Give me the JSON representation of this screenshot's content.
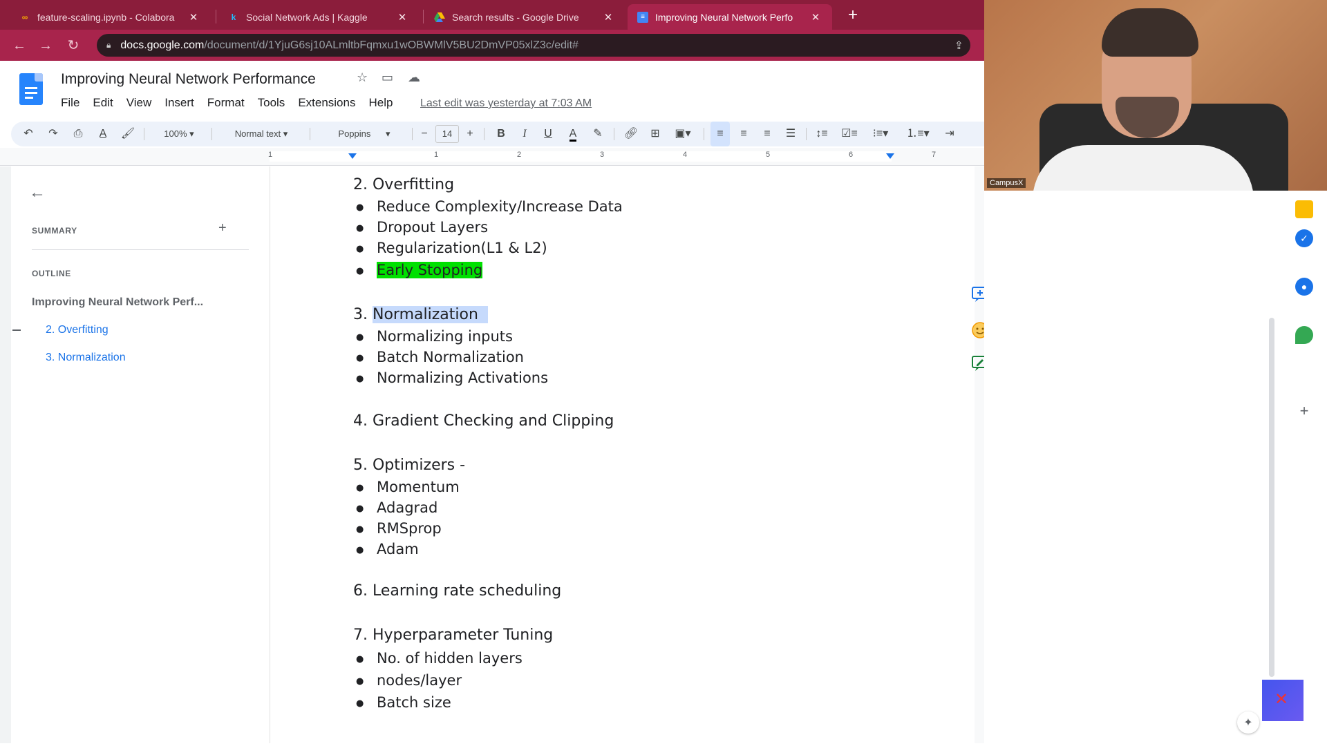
{
  "tabs": [
    {
      "title": "feature-scaling.ipynb - Colabora",
      "icon": "colab-icon",
      "active": false
    },
    {
      "title": "Social Network Ads | Kaggle",
      "icon": "kaggle-icon",
      "active": false
    },
    {
      "title": "Search results - Google Drive",
      "icon": "drive-icon",
      "active": false
    },
    {
      "title": "Improving Neural Network Perfo",
      "icon": "docs-icon",
      "active": true
    }
  ],
  "address": {
    "host": "docs.google.com",
    "path": "/document/d/1YjuG6sj10ALmltbFqmxu1wOBWMlV5BU2DmVP05xlZ3c/edit#"
  },
  "doc": {
    "title": "Improving Neural Network Performance",
    "menus": [
      "File",
      "Edit",
      "View",
      "Insert",
      "Format",
      "Tools",
      "Extensions",
      "Help"
    ],
    "last_edit": "Last edit was yesterday at 7:03 AM"
  },
  "toolbar": {
    "zoom": "100%",
    "style": "Normal text",
    "font": "Poppins",
    "font_size": "14"
  },
  "ruler": {
    "numbers": [
      "1",
      "1",
      "2",
      "3",
      "4",
      "5",
      "6",
      "7"
    ]
  },
  "outline": {
    "summary_label": "SUMMARY",
    "outline_label": "OUTLINE",
    "items": [
      {
        "text": "Improving Neural Network Perf...",
        "level": 0
      },
      {
        "text": "2. Overfitting",
        "level": 1
      },
      {
        "text": "3. Normalization",
        "level": 1
      }
    ]
  },
  "content": {
    "s2": "2. Overfitting",
    "s2_items": [
      "Reduce Complexity/Increase Data",
      "Dropout Layers",
      "Regularization(L1 & L2)",
      "Early Stopping"
    ],
    "s3_num": "3.",
    "s3_text": "Normalization",
    "s3_items": [
      "Normalizing inputs",
      "Batch Normalization",
      "Normalizing Activations"
    ],
    "s4": "4. Gradient Checking and Clipping",
    "s5": "5. Optimizers -",
    "s5_items": [
      "Momentum",
      "Adagrad",
      "RMSprop",
      "Adam"
    ],
    "s6": "6. Learning rate scheduling",
    "s7": "7. Hyperparameter Tuning",
    "s7_items": [
      "No. of hidden layers",
      "nodes/layer",
      "Batch size"
    ]
  },
  "webcam": {
    "label": "CampusX"
  },
  "colors": {
    "tab_bar": "#8b1d3b",
    "highlight_green": "#00e000",
    "selection": "#c6dafc",
    "docs_blue": "#2684fc"
  }
}
